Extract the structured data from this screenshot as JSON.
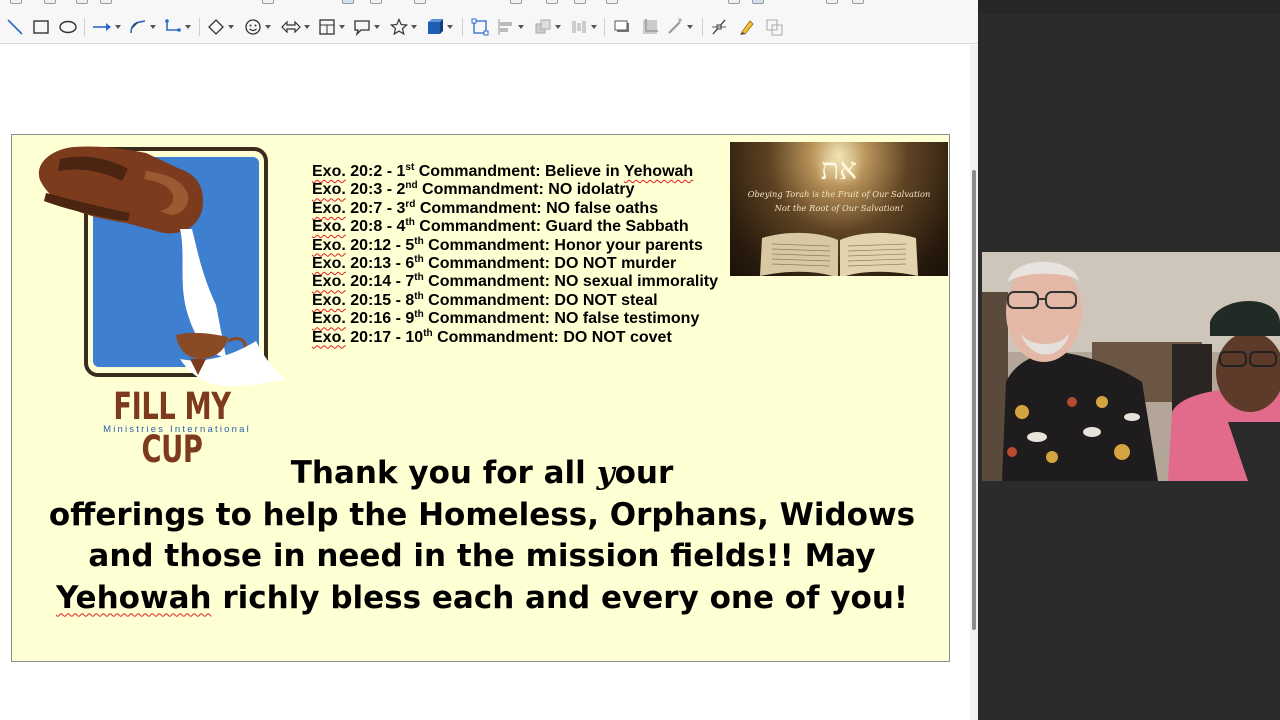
{
  "colors": {
    "slide_background": "#ffffd4",
    "logo_blue": "#3f7fcf",
    "logo_brown": "#7d3a1c",
    "side_panel": "#2b2b2b",
    "spellcheck": "#e02020"
  },
  "toolbar": {
    "tools": [
      "line-tool-icon",
      "rectangle-tool-icon",
      "ellipse-tool-icon",
      "lines-arrows-icon",
      "curves-icon",
      "connectors-icon",
      "basic-shapes-icon",
      "symbol-shapes-icon",
      "block-arrows-icon",
      "flowchart-icon",
      "callouts-icon",
      "stars-icon",
      "3d-objects-icon",
      "transformations-icon",
      "align-icon",
      "arrange-icon",
      "distribute-icon",
      "shadow-icon",
      "crop-icon",
      "filter-icon",
      "points-icon",
      "glue-points-icon",
      "toggle-extrusion-icon"
    ]
  },
  "slide": {
    "logo": {
      "title": "FILL MY CUP",
      "subtitle": "Ministries International"
    },
    "commandments": [
      {
        "ref": "Exo.",
        "pre": " 20:2 - 1",
        "ord": "st",
        "post": " Commandment: Believe in ",
        "spell": "Yehowah"
      },
      {
        "ref": "Exo.",
        "pre": " 20:3 - 2",
        "ord": "nd",
        "post": " Commandment: NO idolatry",
        "spell": ""
      },
      {
        "ref": "Exo.",
        "pre": " 20:7 - 3",
        "ord": "rd",
        "post": " Commandment: NO false oaths",
        "spell": ""
      },
      {
        "ref": "Exo.",
        "pre": " 20:8 - 4",
        "ord": "th",
        "post": " Commandment: Guard the Sabbath",
        "spell": ""
      },
      {
        "ref": "Exo.",
        "pre": " 20:12 - 5",
        "ord": "th",
        "post": " Commandment: Honor your parents",
        "spell": ""
      },
      {
        "ref": "Exo.",
        "pre": " 20:13 - 6",
        "ord": "th",
        "post": " Commandment: DO NOT murder",
        "spell": ""
      },
      {
        "ref": "Exo.",
        "pre": " 20:14 - 7",
        "ord": "th",
        "post": " Commandment: NO sexual immorality",
        "spell": ""
      },
      {
        "ref": "Exo.",
        "pre": " 20:15 - 8",
        "ord": "th",
        "post": " Commandment: DO NOT steal",
        "spell": ""
      },
      {
        "ref": "Exo.",
        "pre": " 20:16 - 9",
        "ord": "th",
        "post": " Commandment: NO false testimony",
        "spell": ""
      },
      {
        "ref": "Exo.",
        "pre": " 20:17 - 10",
        "ord": "th",
        "post": " Commandment: DO NOT covet",
        "spell": ""
      }
    ],
    "image": {
      "hebrew": "את",
      "line1": "Obeying Torah is the Fruit of Our Salvation",
      "line2": "Not the Root of Our Salvation!"
    },
    "thanks": {
      "line1_a": "Thank you for all ",
      "line1_y": "y",
      "line1_b": "our",
      "line2": "offerings to help the Homeless, Orphans, Widows",
      "line3": "and those in need in the mission fields!!  May",
      "line4_spell": "Yehowah",
      "line4_rest": " richly bless each and every one of you!"
    }
  }
}
